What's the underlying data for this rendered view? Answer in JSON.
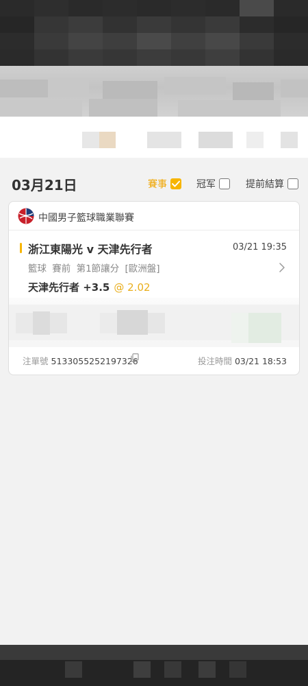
{
  "filter": {
    "date": "03月21日",
    "options": [
      {
        "label": "賽事",
        "checked": true
      },
      {
        "label": "冠军",
        "checked": false
      },
      {
        "label": "提前結算",
        "checked": false
      }
    ]
  },
  "bet": {
    "league": "中國男子籃球職業聯賽",
    "match": "浙江東陽光 v 天津先行者",
    "match_time": "03/21 19:35",
    "market": "籃球  賽前  第1節讓分  [歐洲盤]",
    "selection": "天津先行者 +3.5",
    "odds": "@ 2.02",
    "ref_label": "注單號",
    "ref_number": "5133055252197326",
    "placed_label": "投注時間",
    "placed_time": "03/21 18:53"
  },
  "colors": {
    "accent": "#f7b500",
    "odds": "#e9ae1c",
    "background": "#f2f2f2"
  }
}
